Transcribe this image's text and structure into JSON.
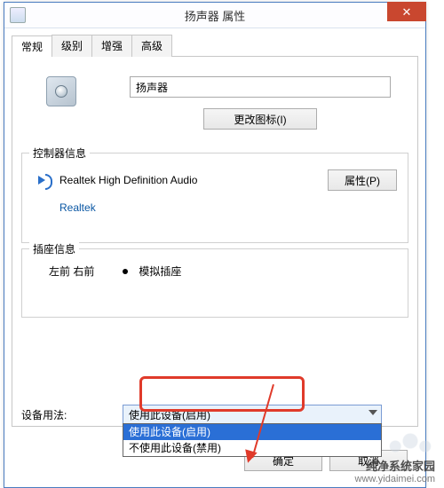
{
  "window": {
    "title": "扬声器 属性",
    "close_glyph": "✕"
  },
  "tabs": [
    "常规",
    "级别",
    "增强",
    "高级"
  ],
  "device_name": "扬声器",
  "change_icon_label": "更改图标(I)",
  "controller": {
    "legend": "控制器信息",
    "name": "Realtek High Definition Audio",
    "brand": "Realtek",
    "prop_button": "属性(P)"
  },
  "jack": {
    "legend": "插座信息",
    "lr": "左前 右前",
    "type": "模拟插座"
  },
  "usage": {
    "label": "设备用法:",
    "selected": "使用此设备(启用)",
    "options": [
      "使用此设备(启用)",
      "不使用此设备(禁用)"
    ]
  },
  "buttons": {
    "ok": "确定",
    "cancel": "取消"
  },
  "watermark": {
    "line1": "纯净系统家园",
    "line2": "www.yidaimei.com"
  }
}
